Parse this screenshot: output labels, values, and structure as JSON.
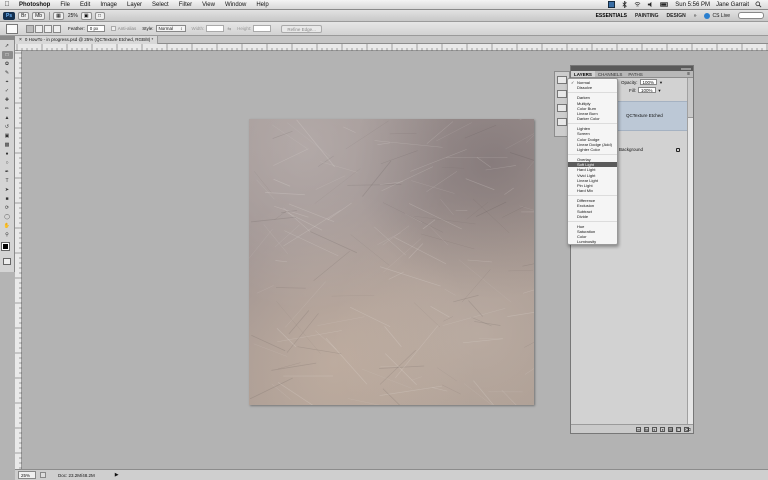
{
  "menubar": {
    "app_name": "Photoshop",
    "items": [
      "File",
      "Edit",
      "Image",
      "Layer",
      "Select",
      "Filter",
      "View",
      "Window",
      "Help"
    ],
    "clock": "Sun 5:56 PM",
    "user": "Jane Garrait"
  },
  "appbar": {
    "zoom": "25%",
    "workspaces": [
      "ESSENTIALS",
      "PAINTING",
      "DESIGN"
    ],
    "cs_live": "CS Live"
  },
  "options": {
    "feather_label": "Feather:",
    "feather_value": "0 px",
    "antialias_label": "Anti-alias",
    "style_label": "Style:",
    "style_value": "Normal",
    "width_label": "Width:",
    "height_label": "Height:",
    "refine_label": "Refine Edge..."
  },
  "document": {
    "tab_title": "0 HowTo - in progress.psd @ 25% (QCTexture Etched, RGB/8) *"
  },
  "status": {
    "zoom": "25%",
    "doc_info": "Doc: 23.2M/48.2M"
  },
  "layers_panel": {
    "tabs": [
      "LAYERS",
      "CHANNELS",
      "PATHS"
    ],
    "opacity_label": "Opacity:",
    "opacity_value": "100%",
    "fill_label": "Fill:",
    "fill_value": "100%",
    "layers": [
      {
        "name": "QCTexture Etched",
        "selected": true
      },
      {
        "name": "Background",
        "locked": true
      }
    ]
  },
  "blend_menu": {
    "checked": "Normal",
    "highlighted": "Soft Light",
    "groups": [
      [
        "Normal",
        "Dissolve"
      ],
      [
        "Darken",
        "Multiply",
        "Color Burn",
        "Linear Burn",
        "Darker Color"
      ],
      [
        "Lighten",
        "Screen",
        "Color Dodge",
        "Linear Dodge (Add)",
        "Lighter Color"
      ],
      [
        "Overlay",
        "Soft Light",
        "Hard Light",
        "Vivid Light",
        "Linear Light",
        "Pin Light",
        "Hard Mix"
      ],
      [
        "Difference",
        "Exclusion",
        "Subtract",
        "Divide"
      ],
      [
        "Hue",
        "Saturation",
        "Color",
        "Luminosity"
      ]
    ]
  },
  "colors": {
    "foreground": "#000000",
    "background": "#ffffff",
    "selected_layer": "#bcc8d6",
    "menu_highlight": "#5b5b5b"
  }
}
